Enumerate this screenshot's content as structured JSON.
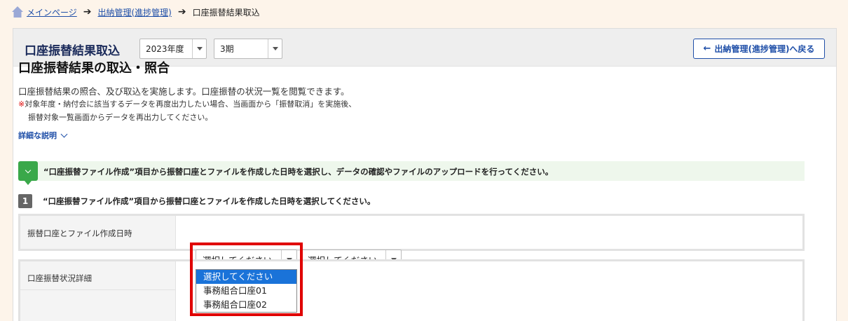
{
  "breadcrumb": {
    "home": "メインページ",
    "level2": "出納管理(進捗管理)",
    "current": "口座振替結果取込"
  },
  "header": {
    "title": "口座振替結果取込",
    "year_select": "2023年度",
    "period_select": "3期",
    "back_button": "出納管理(進捗管理)へ戻る"
  },
  "main": {
    "heading": "口座振替結果の取込・照合",
    "description": "口座振替結果の照合、及び取込を実施します。口座振替の状況一覧を閲覧できます。",
    "note_mark": "※",
    "note_line1": "対象年度・納付会に該当するデータを再度出力したい場合、当画面から「振替取消」を実施後、",
    "note_line2": "振替対象一覧画面からデータを再出力してください。",
    "detail_link": "詳細な説明"
  },
  "info": {
    "text": "“口座振替ファイル作成”項目から振替口座とファイルを作成した日時を選択し、データの確認やファイルのアップロードを行ってください。"
  },
  "step1": {
    "number": "1",
    "text": "“口座振替ファイル作成”項目から振替口座とファイルを作成した日時を選択してください。"
  },
  "form": {
    "label": "振替口座とファイル作成日時",
    "select1_value": "選択してください",
    "select2_value": "選択してください",
    "dropdown_options": [
      "選択してください",
      "事務組合口座01",
      "事務組合口座02"
    ]
  },
  "status": {
    "label": "口座振替状況詳細"
  },
  "colors": {
    "link": "#1f4fa8",
    "highlight": "#e00000",
    "option_selected": "#1a73d9",
    "info_icon": "#3aa84a"
  }
}
